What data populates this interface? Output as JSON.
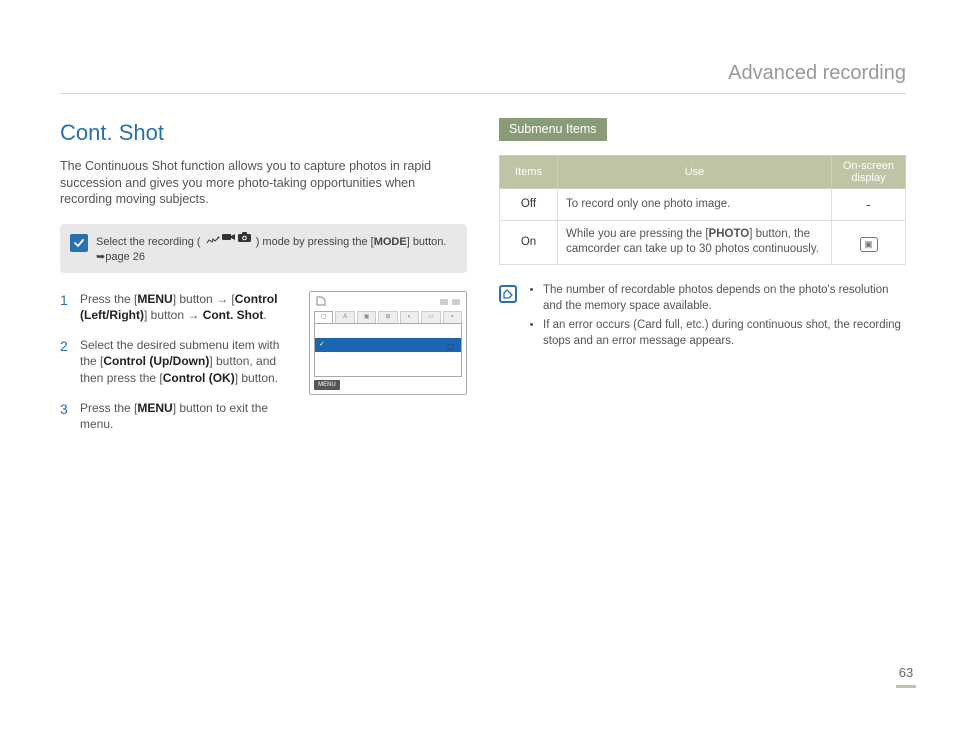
{
  "page_header": "Advanced recording",
  "section_title": "Cont. Shot",
  "intro": "The Continuous Shot function allows you to capture photos in rapid succession and gives you more photo-taking opportunities when recording moving subjects.",
  "note": {
    "prefix": "Select the recording (",
    "suffix": ") mode by pressing the [",
    "mode_btn": "MODE",
    "close": "] button. ",
    "page_ref": "page 26"
  },
  "steps": [
    {
      "num": "1",
      "parts": [
        "Press the [",
        "MENU",
        "] button → [",
        "Control (Left/Right)",
        "] button → ",
        "Cont. Shot",
        "."
      ]
    },
    {
      "num": "2",
      "parts": [
        "Select the desired submenu item with the [",
        "Control (Up/Down)",
        "] button, and then press the [",
        "Control (OK)",
        "] button."
      ]
    },
    {
      "num": "3",
      "parts": [
        "Press the [",
        "MENU",
        "] button to exit the menu."
      ]
    }
  ],
  "lcd": {
    "menu_label": "MENU"
  },
  "submenu": {
    "title": "Submenu Items",
    "headers": {
      "items": "Items",
      "use": "Use",
      "display": "On-screen display"
    },
    "rows": [
      {
        "item": "Off",
        "use": "To record only one photo image.",
        "display": "-",
        "photo_bold": ""
      },
      {
        "item": "On",
        "use_prefix": "While you are pressing the [",
        "photo_bold": "PHOTO",
        "use_suffix": "] button, the camcorder can take up to 30 photos continuously.",
        "display": "icon"
      }
    ]
  },
  "info": [
    "The number of recordable photos depends on the photo's resolution and the memory space available.",
    "If an error occurs (Card full, etc.) during continuous shot, the recording stops and an error message appears."
  ],
  "page_number": "63"
}
